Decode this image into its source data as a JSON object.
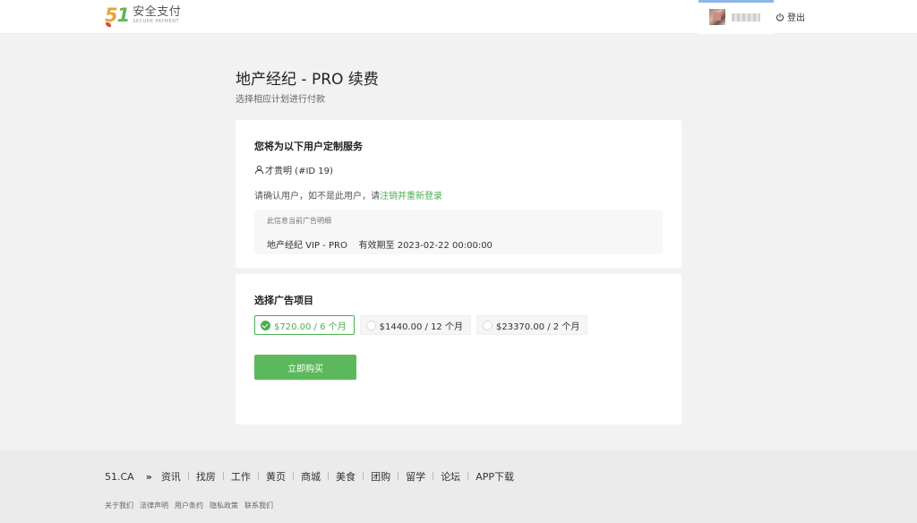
{
  "header": {
    "logo_number_5": "5",
    "logo_number_1": "1",
    "logo_cn": "安全支付",
    "logo_en": "SECURE PAYMENT",
    "logout_label": "登出"
  },
  "page": {
    "title": "地产经纪 - PRO 续费",
    "subtitle": "选择相应计划进行付款"
  },
  "user_card": {
    "title": "您将为以下用户定制服务",
    "user_name": "才贵明 (#ID 19)",
    "confirm_prefix": "请确认用户，如不是此用户，请",
    "confirm_link": "注销并重新登录",
    "info_label": "此信息当前广告明细",
    "info_value": "地产经纪 VIP - PRO    有效期至 2023-02-22 00:00:00"
  },
  "plan_card": {
    "title": "选择广告项目",
    "plans": [
      {
        "label": "$720.00 / 6 个月",
        "selected": true
      },
      {
        "label": "$1440.00 / 12 个月",
        "selected": false
      },
      {
        "label": "$23370.00 / 2 个月",
        "selected": false
      }
    ],
    "buy_label": "立即购买"
  },
  "footer": {
    "brand": "51.CA",
    "raquo": "»",
    "nav": [
      "资讯",
      "找房",
      "工作",
      "黄页",
      "商城",
      "美食",
      "团购",
      "留学",
      "论坛",
      "APP下载"
    ],
    "separator": "|",
    "links": [
      "关于我们",
      "法律声明",
      "用户条约",
      "隐私政策",
      "联系我们"
    ]
  },
  "colors": {
    "accent": "#5cb85c",
    "link_green": "#4caf50",
    "page_bg": "#f2f2f2"
  }
}
